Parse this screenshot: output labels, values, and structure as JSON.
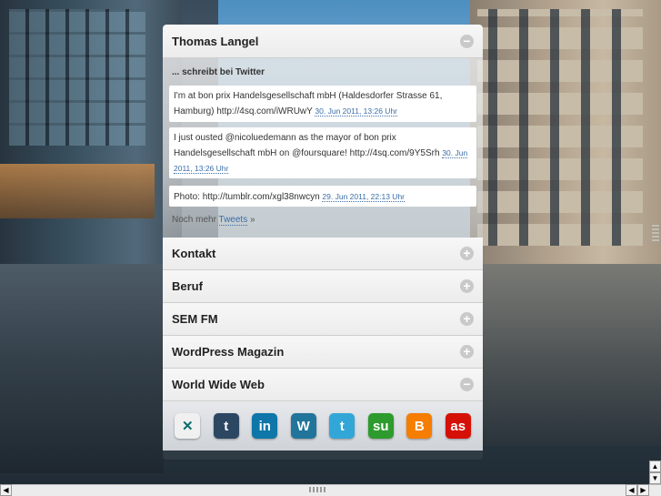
{
  "panel": {
    "header_title": "Thomas Langel",
    "twitter": {
      "subheading": "... schreibt bei Twitter",
      "tweets": [
        {
          "text": "I'm at bon prix Handelsgesellschaft mbH (Haldesdorfer Strasse 61, Hamburg) http://4sq.com/iWRUwY",
          "date": "30. Jun 2011, 13:26 Uhr"
        },
        {
          "text": "I just ousted @nicoluedemann as the mayor of bon prix Handelsgesellschaft mbH on @foursquare! http://4sq.com/9Y5Srh",
          "date": "30. Jun 2011, 13:26 Uhr"
        },
        {
          "text": "Photo: http://tumblr.com/xgl38nwcyn",
          "date": "29. Jun 2011, 22:13 Uhr"
        }
      ],
      "more_prefix": "Noch mehr",
      "more_link": "Tweets",
      "more_suffix": "»"
    },
    "sections": [
      {
        "label": "Kontakt",
        "toggle": "+"
      },
      {
        "label": "Beruf",
        "toggle": "+"
      },
      {
        "label": "SEM FM",
        "toggle": "+"
      },
      {
        "label": "WordPress Magazin",
        "toggle": "+"
      },
      {
        "label": "World Wide Web",
        "toggle": "−"
      }
    ],
    "header_toggle": "−",
    "social_icons": [
      {
        "name": "xing-icon",
        "glyph": "✕",
        "color": "#f0f0f0",
        "fg": "#0a6d6c"
      },
      {
        "name": "tumblr-icon",
        "glyph": "t",
        "color": "#2c4762",
        "fg": "#ffffff"
      },
      {
        "name": "linkedin-icon",
        "glyph": "in",
        "color": "#0e76a8",
        "fg": "#ffffff"
      },
      {
        "name": "wordpress-icon",
        "glyph": "W",
        "color": "#21759b",
        "fg": "#ffffff"
      },
      {
        "name": "twitter-icon",
        "glyph": "t",
        "color": "#33a6d8",
        "fg": "#ffffff"
      },
      {
        "name": "stumbleupon-icon",
        "glyph": "su",
        "color": "#2d9b2d",
        "fg": "#ffffff"
      },
      {
        "name": "blogger-icon",
        "glyph": "B",
        "color": "#f57d00",
        "fg": "#ffffff"
      },
      {
        "name": "lastfm-icon",
        "glyph": "as",
        "color": "#d51007",
        "fg": "#ffffff"
      }
    ]
  },
  "scrollbar": {
    "up": "▲",
    "down": "▼",
    "left": "◀",
    "right": "▶"
  }
}
